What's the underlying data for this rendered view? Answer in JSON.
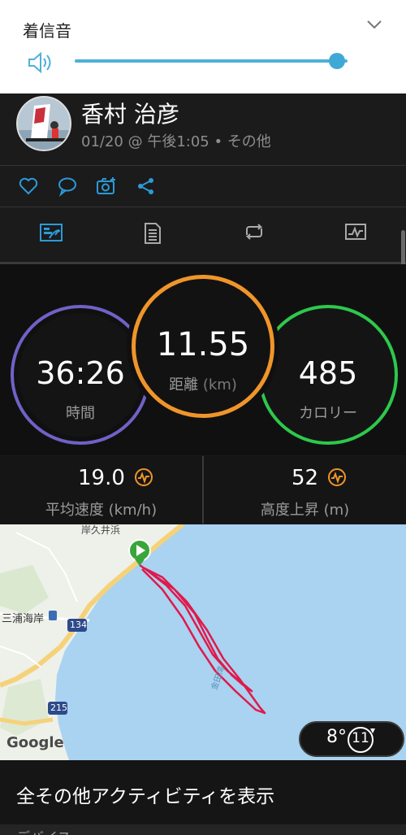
{
  "volume": {
    "title": "着信音",
    "level": 0.96
  },
  "activity": {
    "user_name": "香村 治彦",
    "meta": "01/20 @ 午後1:05 • その他"
  },
  "social": {
    "icons": [
      "heart-icon",
      "comment-icon",
      "camera-add-icon",
      "share-icon"
    ]
  },
  "tabs": {
    "items": [
      "summary-tab",
      "details-tab",
      "laps-tab",
      "charts-tab"
    ],
    "active": 0
  },
  "stats": {
    "time": {
      "value": "36:26",
      "label": "時間",
      "color": "#7b6fd0"
    },
    "distance": {
      "value": "11.55",
      "label": "距離",
      "unit": "(km)",
      "color": "#f0952a"
    },
    "calories": {
      "value": "485",
      "label": "カロリー",
      "color": "#2dc84d"
    }
  },
  "summary": {
    "avg_speed": {
      "value": "19.0",
      "label": "平均速度 (km/h)"
    },
    "elevation_gain": {
      "value": "52",
      "label": "高度上昇 (m)"
    }
  },
  "map": {
    "place_top": "岸久井浜",
    "place_left": "三浦海岸",
    "road_134": "134",
    "road_215": "215",
    "sea_label": "金田湾",
    "google": "Google"
  },
  "weather": {
    "temp": "8°",
    "wind": "11"
  },
  "footer": {
    "show_all": "全その他アクティビティを表示",
    "next_section": "デバイス"
  },
  "colors": {
    "accent": "#2c9ad8",
    "track": "#e0194c",
    "pulse": "#f0952a"
  }
}
